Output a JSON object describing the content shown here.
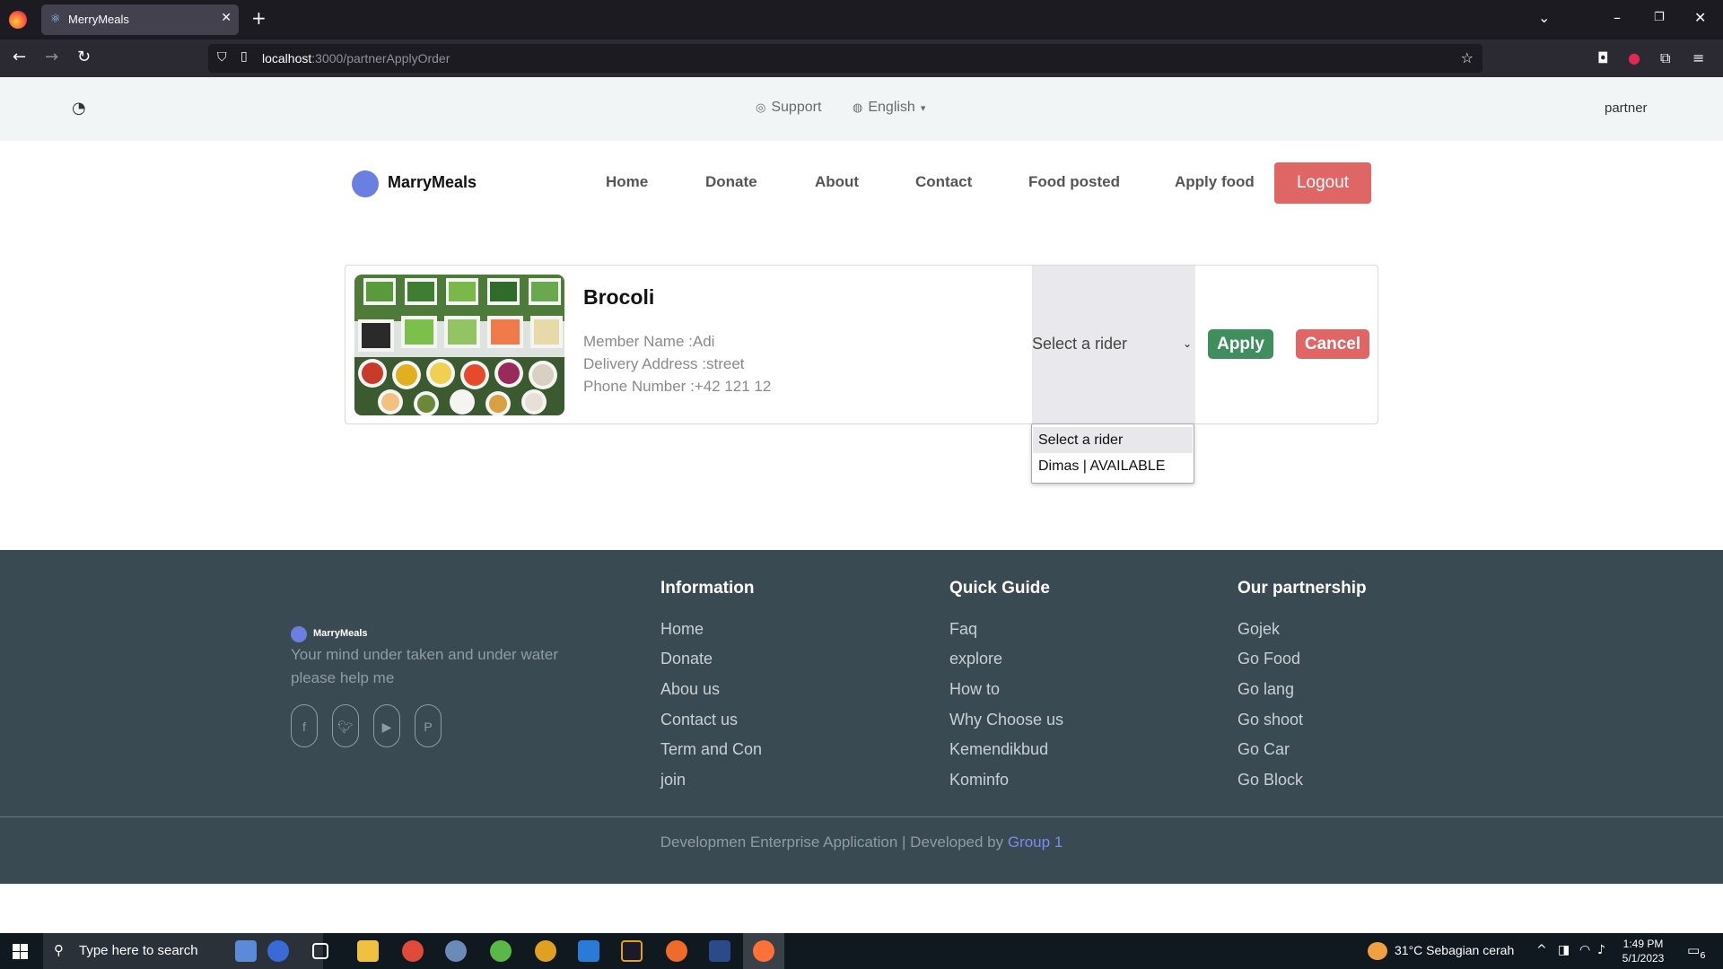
{
  "browser": {
    "tab_title": "MerryMeals",
    "url_host": "localhost",
    "url_rest": ":3000/partnerApplyOrder"
  },
  "topbar": {
    "support": "Support",
    "language": "English",
    "role": "partner"
  },
  "nav": {
    "brand": "MarryMeals",
    "links": [
      "Home",
      "Donate",
      "About",
      "Contact",
      "Food posted",
      "Apply food"
    ],
    "logout": "Logout"
  },
  "order": {
    "title": "Brocoli",
    "member": "Member Name :Adi",
    "address": "Delivery Address :street",
    "phone": "Phone Number :+42 121 12",
    "select_value": "Select a rider",
    "options": [
      "Select a rider",
      "Dimas | AVAILABLE"
    ],
    "apply": "Apply",
    "cancel": "Cancel"
  },
  "footer": {
    "brand": "MarryMeals",
    "tagline": "Your mind under taken and under water please help me",
    "social_icons": [
      "facebook-icon",
      "twitter-icon",
      "youtube-icon",
      "pinterest-icon"
    ],
    "columns": [
      {
        "title": "Information",
        "links": [
          "Home",
          "Donate",
          "Abou us",
          "Contact us",
          "Term and Con",
          "join"
        ]
      },
      {
        "title": "Quick Guide",
        "links": [
          "Faq",
          "explore",
          "How to",
          "Why Choose us",
          "Kemendikbud",
          "Kominfo"
        ]
      },
      {
        "title": "Our partnership",
        "links": [
          "Gojek",
          "Go Food",
          "Go lang",
          "Go shoot",
          "Go Car",
          "Go Block"
        ]
      }
    ],
    "copyright": "Developmen Enterprise Application | Developed by ",
    "group": "Group 1"
  },
  "taskbar": {
    "search_placeholder": "Type here to search",
    "weather": "31°C  Sebagian cerah",
    "time": "1:49 PM",
    "date": "5/1/2023",
    "notifications": "6"
  },
  "colors": {
    "accent": "#6b7fe0",
    "danger": "#e06666",
    "success": "#3e8e5e",
    "footer_bg": "#3a4a53"
  }
}
